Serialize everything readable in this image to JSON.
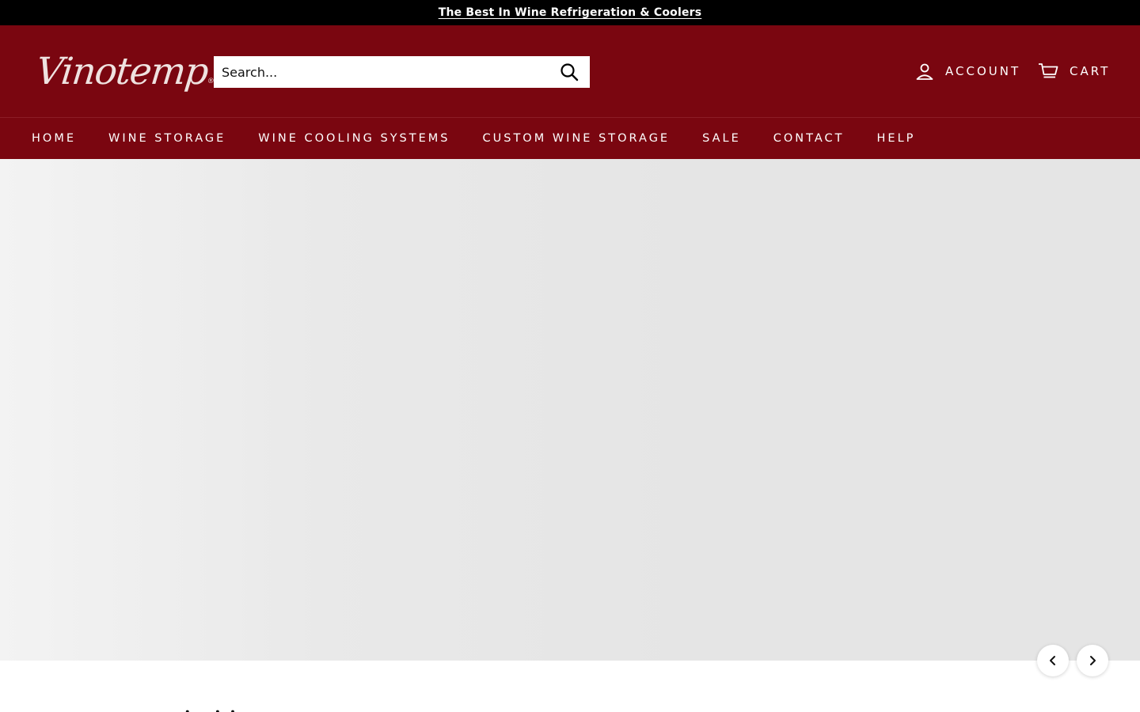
{
  "announcement": {
    "text": "The Best In Wine Refrigeration & Coolers"
  },
  "header": {
    "logo_text": "Vinotemp",
    "logo_mark": "®",
    "search": {
      "placeholder": "Search...",
      "icon": "search-icon"
    },
    "account_label": "ACCOUNT",
    "cart_label": "CART"
  },
  "nav": {
    "items": [
      {
        "label": "HOME"
      },
      {
        "label": "WINE STORAGE"
      },
      {
        "label": "WINE COOLING SYSTEMS"
      },
      {
        "label": "CUSTOM WINE STORAGE"
      },
      {
        "label": "SALE"
      },
      {
        "label": "CONTACT"
      },
      {
        "label": "HELP"
      }
    ]
  },
  "hero": {
    "prev_icon": "chevron-left-icon",
    "next_icon": "chevron-right-icon"
  },
  "below": {
    "partial_heading": "· . ·  ·"
  },
  "colors": {
    "announcement_bg": "#000000",
    "header_bg": "#7a0610",
    "hero_bg": "#e5e5e5",
    "text_light": "#ffffff"
  }
}
